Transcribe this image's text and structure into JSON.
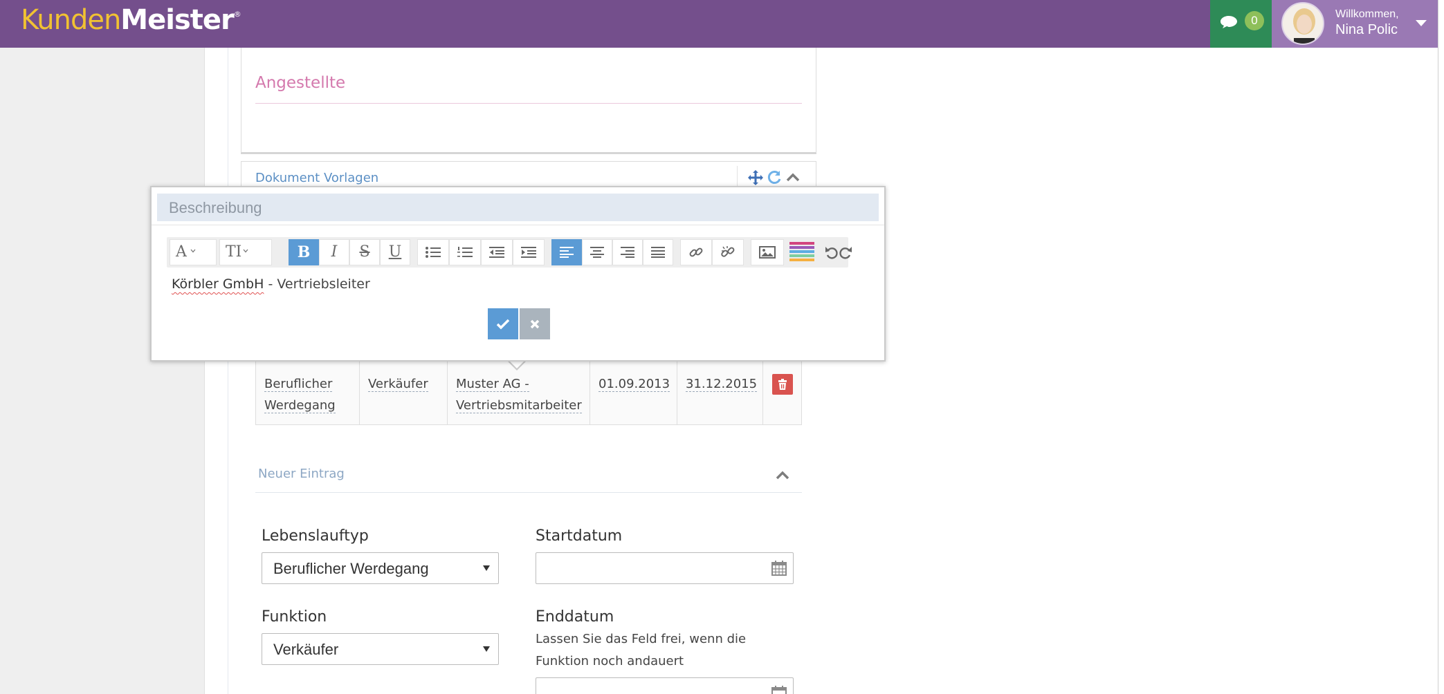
{
  "app": {
    "logo_part1": "Kunden",
    "logo_part2": "Meister",
    "logo_reg": "®",
    "chat_count": "0",
    "welcome": "Willkommen,",
    "user_name": "Nina Polic"
  },
  "colors": {
    "topbar": "#744f8c",
    "chat": "#2e8b57",
    "user": "#9a79b4",
    "accent_blue": "#5b9bd5",
    "danger": "#d9534f",
    "pink": "#d479ad"
  },
  "sections": {
    "angestellte_title": "Angestellte",
    "dokument_vorlagen_title": "Dokument Vorlagen",
    "neuer_eintrag_title": "Neuer Eintrag"
  },
  "table": {
    "row": {
      "typ_line1": "Beruflicher",
      "typ_line2": "Werdegang",
      "funktion": "Verkäufer",
      "beschreibung_line1": "Muster AG -",
      "beschreibung_line2": "Vertriebsmitarbeiter",
      "startdatum": "01.09.2013",
      "enddatum": "31.12.2015"
    }
  },
  "form": {
    "lebenslauftyp_label": "Lebenslauftyp",
    "lebenslauftyp_value": "Beruflicher Werdegang",
    "startdatum_label": "Startdatum",
    "funktion_label": "Funktion",
    "funktion_value": "Verkäufer",
    "enddatum_label": "Enddatum",
    "enddatum_hint": "Lassen Sie das Feld frei, wenn die Funktion noch andauert"
  },
  "popup": {
    "title": "Beschreibung",
    "toolbar": {
      "font_label": "A",
      "size_label": "TI",
      "bold_label": "B",
      "italic_label": "I",
      "strike_label": "S",
      "underline_label": "U"
    },
    "editor_company": "Körbler GmbH",
    "editor_rest": " - Vertriebsleiter"
  },
  "icons": [
    "comment-icon",
    "move-icon",
    "refresh-icon",
    "chevron-up-icon",
    "trash-icon",
    "calendar-icon",
    "check-icon",
    "times-icon",
    "link-icon",
    "unlink-icon",
    "image-icon",
    "undo-icon",
    "redo-icon"
  ]
}
